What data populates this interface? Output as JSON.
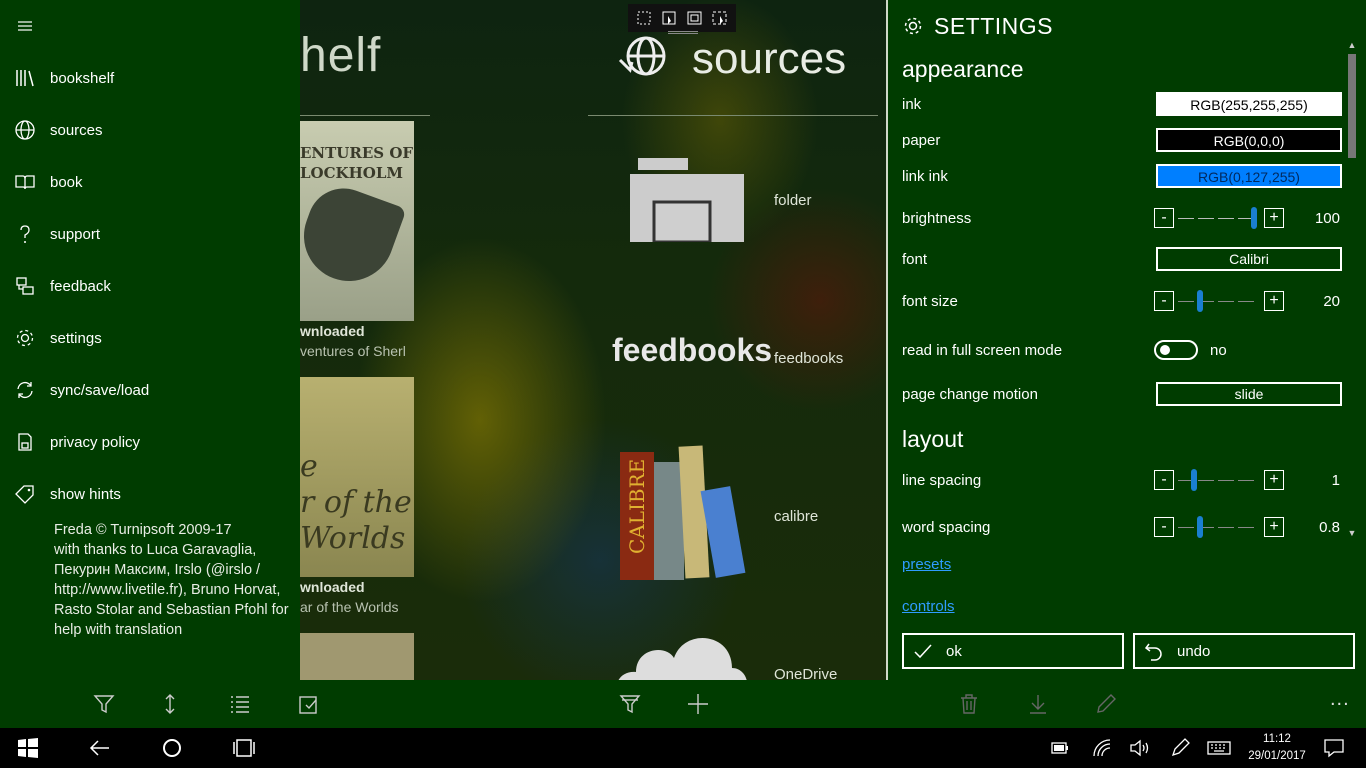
{
  "colors": {
    "pane_bg": "#003c00",
    "accent_blue": "#1a7fd0",
    "link_blue": "#2f9cff",
    "link_ink_swatch": "#007fff"
  },
  "background": {
    "bookshelf_title": "helf",
    "books": [
      {
        "cover_text": "ENTURES OF\nLOCKHOLM",
        "status": "wnloaded",
        "title": "ventures of Sherl"
      },
      {
        "cover_text": "e\nr of the\nWorlds",
        "status": "wnloaded",
        "title": "ar of the Worlds"
      }
    ],
    "sources_title": "sources",
    "sources": [
      {
        "label": "folder",
        "icon": "folder-icon"
      },
      {
        "label": "feedbooks",
        "icon": "feedbooks-logo",
        "logo_text": "feedbooks"
      },
      {
        "label": "calibre",
        "icon": "calibre-books-icon",
        "logo_text": "CALIBRE"
      },
      {
        "label": "OneDrive",
        "icon": "cloud-icon"
      }
    ]
  },
  "nav": {
    "items": [
      {
        "label": "bookshelf",
        "icon": "bookshelf-icon"
      },
      {
        "label": "sources",
        "icon": "globe-icon"
      },
      {
        "label": "book",
        "icon": "open-book-icon"
      },
      {
        "label": "support",
        "icon": "question-icon"
      },
      {
        "label": "feedback",
        "icon": "feedback-icon"
      },
      {
        "label": "settings",
        "icon": "gear-icon"
      },
      {
        "label": "sync/save/load",
        "icon": "sync-icon"
      },
      {
        "label": "privacy policy",
        "icon": "privacy-icon"
      },
      {
        "label": "show hints",
        "icon": "tag-icon"
      }
    ],
    "credits": "Freda © Turnipsoft 2009-17\nwith thanks to Luca Garavaglia,\nПекурин Максим, Irslo (@irslo /\nhttp://www.livetile.fr), Bruno Horvat,\nRasto Stolar and Sebastian Pfohl for\nhelp with translation"
  },
  "settings": {
    "title": "SETTINGS",
    "appearance_heading": "appearance",
    "ink_label": "ink",
    "ink_value": "RGB(255,255,255)",
    "paper_label": "paper",
    "paper_value": "RGB(0,0,0)",
    "link_ink_label": "link ink",
    "link_ink_value": "RGB(0,127,255)",
    "brightness_label": "brightness",
    "brightness_value": "100",
    "font_label": "font",
    "font_value": "Calibri",
    "font_size_label": "font size",
    "font_size_value": "20",
    "fullscreen_label": "read in full screen mode",
    "fullscreen_value": "no",
    "page_motion_label": "page change motion",
    "page_motion_value": "slide",
    "layout_heading": "layout",
    "line_spacing_label": "line spacing",
    "line_spacing_value": "1",
    "word_spacing_label": "word spacing",
    "word_spacing_value": "0.8",
    "presets_link": "presets",
    "controls_link": "controls",
    "ok_label": "ok",
    "undo_label": "undo",
    "minus": "-",
    "plus": "+"
  },
  "command_bar": {
    "items": [
      "filter-icon",
      "sort-icon",
      "list-icon",
      "select-icon",
      "source-filter-icon",
      "add-icon",
      "delete-icon",
      "download-icon",
      "edit-icon"
    ],
    "more": "..."
  },
  "taskbar": {
    "time": "11:12",
    "date": "29/01/2017"
  }
}
